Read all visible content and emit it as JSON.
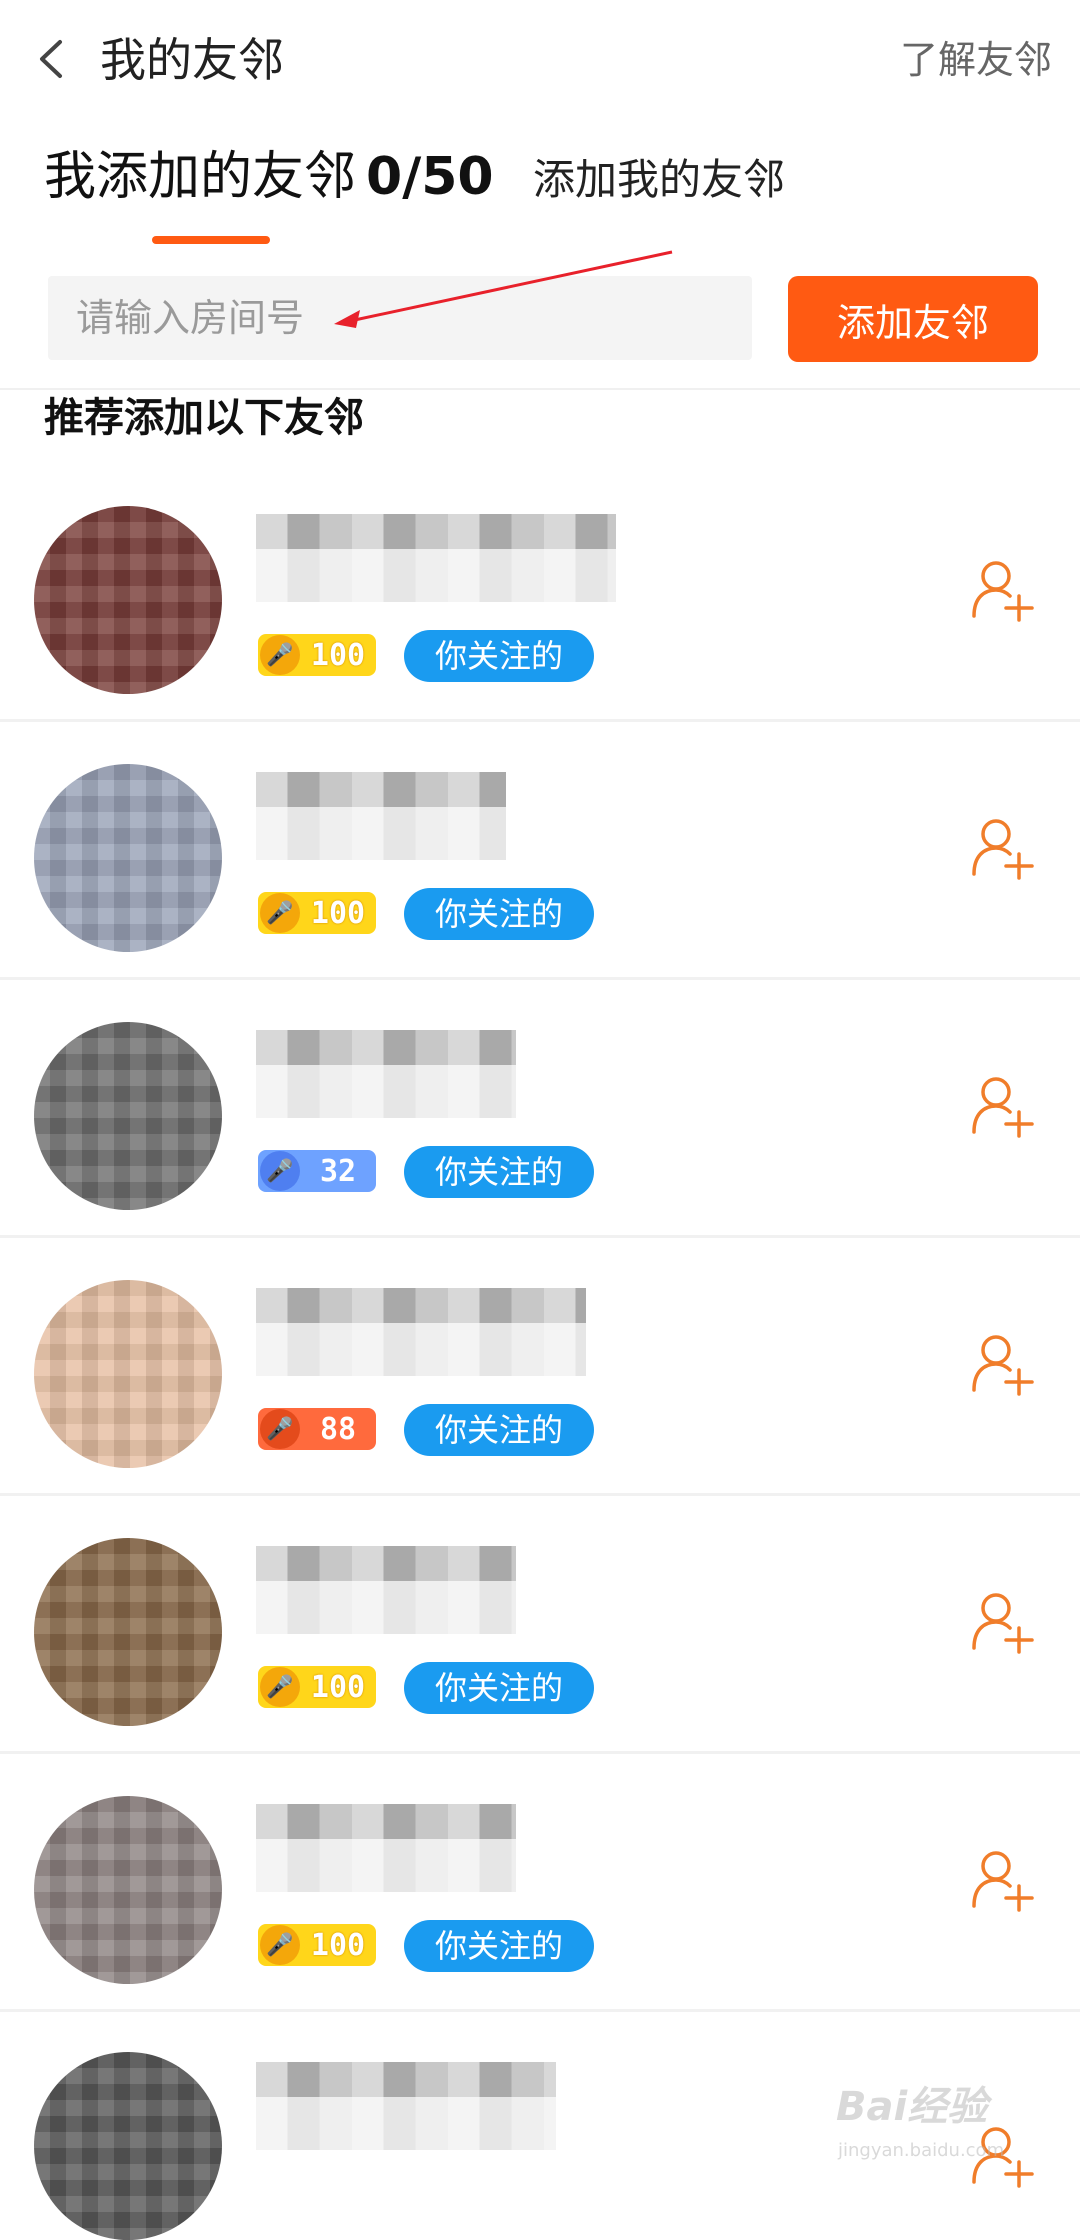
{
  "header": {
    "title": "我的友邻",
    "learn_link": "了解友邻"
  },
  "tabs": {
    "mine_label": "我添加的友邻",
    "mine_count": "0/50",
    "others_label": "添加我的友邻"
  },
  "search": {
    "placeholder": "请输入房间号",
    "value": "",
    "button_label": "添加友邻"
  },
  "section_title": "推荐添加以下友邻",
  "friends": [
    {
      "level": "100",
      "badge_color": "#ffd61a",
      "tag": "你关注的"
    },
    {
      "level": "100",
      "badge_color": "#ffd61a",
      "tag": "你关注的"
    },
    {
      "level": "32",
      "badge_color": "#6ea2ff",
      "tag": "你关注的"
    },
    {
      "level": "88",
      "badge_color": "#ff6a3d",
      "tag": "你关注的"
    },
    {
      "level": "100",
      "badge_color": "#ffd61a",
      "tag": "你关注的"
    },
    {
      "level": "100",
      "badge_color": "#ffd61a",
      "tag": "你关注的"
    }
  ],
  "watermark": {
    "brand": "Bai经验",
    "site": "jingyan.baidu.com"
  },
  "colors": {
    "accent": "#ff5a12",
    "follow_tag": "#1a9bf0",
    "annotation_arrow": "#e8212b"
  }
}
